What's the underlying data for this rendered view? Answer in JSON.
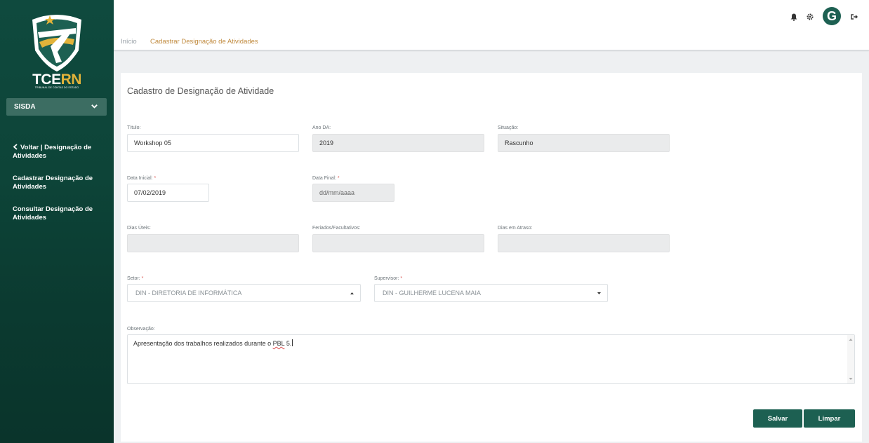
{
  "sidebar": {
    "logo": {
      "name": "TCERN",
      "main": "TCE",
      "accent": "RN",
      "sub": "TRIBUNAL DE CONTAS DO ESTADO"
    },
    "system": {
      "selected": "SISDA"
    },
    "items": [
      {
        "label": "Voltar | Designação de Atividades"
      },
      {
        "label": "Cadastrar Designação de Atividades"
      },
      {
        "label": "Consultar Designação de Atividades"
      }
    ]
  },
  "header": {
    "breadcrumb": {
      "home": "Início",
      "current": "Cadastrar Designação de Atividades"
    },
    "icons": [
      "bell-icon",
      "gear-icon",
      "logout-icon"
    ],
    "avatar": "G"
  },
  "form": {
    "title": "Cadastro de Designação de Atividade",
    "required_mark": "*",
    "titulo": {
      "label": "Título:",
      "value": "Workshop 05"
    },
    "ano": {
      "label": "Ano DA:",
      "value": "2019"
    },
    "situacao": {
      "label": "Situação:",
      "value": "Rascunho"
    },
    "data_inicial": {
      "label": "Data Inicial:",
      "value": "07/02/2019"
    },
    "data_final": {
      "label": "Data Final:",
      "value": "dd/mm/aaaa"
    },
    "dias_uteis": {
      "label": "Dias Úteis:",
      "value": ""
    },
    "feriados": {
      "label": "Feriados/Facultativos:",
      "value": ""
    },
    "dias_atraso": {
      "label": "Dias em Atraso:",
      "value": ""
    },
    "setor": {
      "label": "Setor:",
      "value": "DIN - DIRETORIA DE INFORMÁTICA"
    },
    "supervisor": {
      "label": "Supervisor:",
      "value": "DIN - GUILHERME LUCENA MAIA"
    },
    "observacao": {
      "label": "Observação:",
      "text": "Apresentação dos trabalhos realizados durante o ",
      "flagged": "PBL",
      "tail": " 5."
    }
  },
  "actions": {
    "save": "Salvar",
    "clear": "Limpar"
  },
  "colors": {
    "sidebar": "#0f4a3e",
    "primary": "#1d6052",
    "breadcrumb_active": "#c08a3e",
    "required": "#d9534f"
  }
}
